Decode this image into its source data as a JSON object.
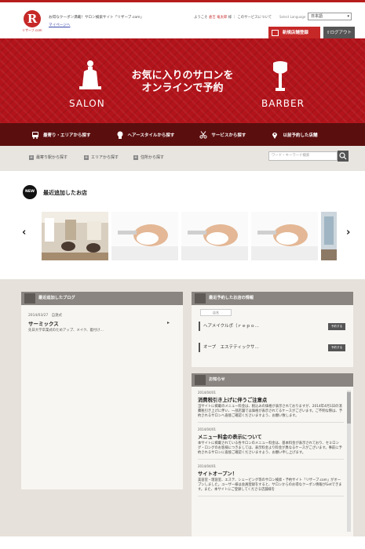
{
  "header": {
    "logo_letter": "R",
    "logo_text": "リザーブ.com",
    "tagline": "お得なクーポン満載！サロン検索サイト「リザーブ.com」",
    "mypage": "マイページへ",
    "welcome_prefix": "ようこそ",
    "username": "倉吉 竜太郎",
    "welcome_suffix": "様 ｜ このサービスについて",
    "lang_label": "Select Language",
    "lang_value": "日本語",
    "register_btn": "新規店舗登録",
    "logout_btn": "ログアウト"
  },
  "hero": {
    "title_line1": "お気に入りのサロンを",
    "title_line2": "オンラインで予約",
    "salon": "SALON",
    "barber": "BARBER",
    "bg_color": "#b3141b"
  },
  "nav": {
    "items": [
      {
        "label": "最寄り・エリアから探す",
        "icon": "bus-icon"
      },
      {
        "label": "ヘアースタイルから探す",
        "icon": "head-icon"
      },
      {
        "label": "サービスから探す",
        "icon": "scissors-icon"
      },
      {
        "label": "以前予約した店舗",
        "icon": "location-pin-icon"
      }
    ]
  },
  "subnav": {
    "items": [
      "最寄り駅から探す",
      "エリアから探す",
      "住所から探す"
    ],
    "search_placeholder": "ワード・キーワード検索"
  },
  "new_shops": {
    "badge": "NEW",
    "title": "最近追加したお店"
  },
  "blog": {
    "header": "最近追加したブログ",
    "date": "2014/03/27　自遠式",
    "title": "サーミックス",
    "excerpt": "先日大学卒業式のためアップ、メイク、着付け…"
  },
  "recent": {
    "header": "最近予約したお店の情報",
    "tag": "店名",
    "items": [
      "ヘアメイクルポ（ｒｅｐｏ…",
      "オープ　エステティックサ…"
    ],
    "button": "予約する"
  },
  "news": {
    "header": "お知らせ",
    "entries": [
      {
        "date": "2014/04/01",
        "title": "消費税引き上げに伴うご注意点",
        "text": "当サイトに掲載のメニュー料金は、税込みの価格が表示されておりますが、2014年4月1日の消費税引き上げに伴い、一部店舗では価格が表示されてるケースがございます。ご不明な際は、予約されるサロンへ直接ご確認くださいますよう、お願い致します。"
      },
      {
        "date": "2014/04/01",
        "title": "メニュー料金の表示について",
        "text": "本サイトに掲載されている各サロンのメニュー料金は、基本料金が表示されており、セミロング・ロングのお客様につきましては、表示料金より料金が異なるケースがございます。事前に予約されるサロンに直接ご確認くださいますよう、お願い申し上げます。"
      },
      {
        "date": "2014/04/01",
        "title": "サイトオープン！",
        "text": "美容室・理容室、エステ、シェービング等のサロン検索・予約サイト「リザーブ.com」がオープンしました。ユーザー様は会員登録をすると、サロンからのお得なクーポン情報がGetできます。また、本サイトにご登録してくださる店舗様を"
      }
    ]
  }
}
